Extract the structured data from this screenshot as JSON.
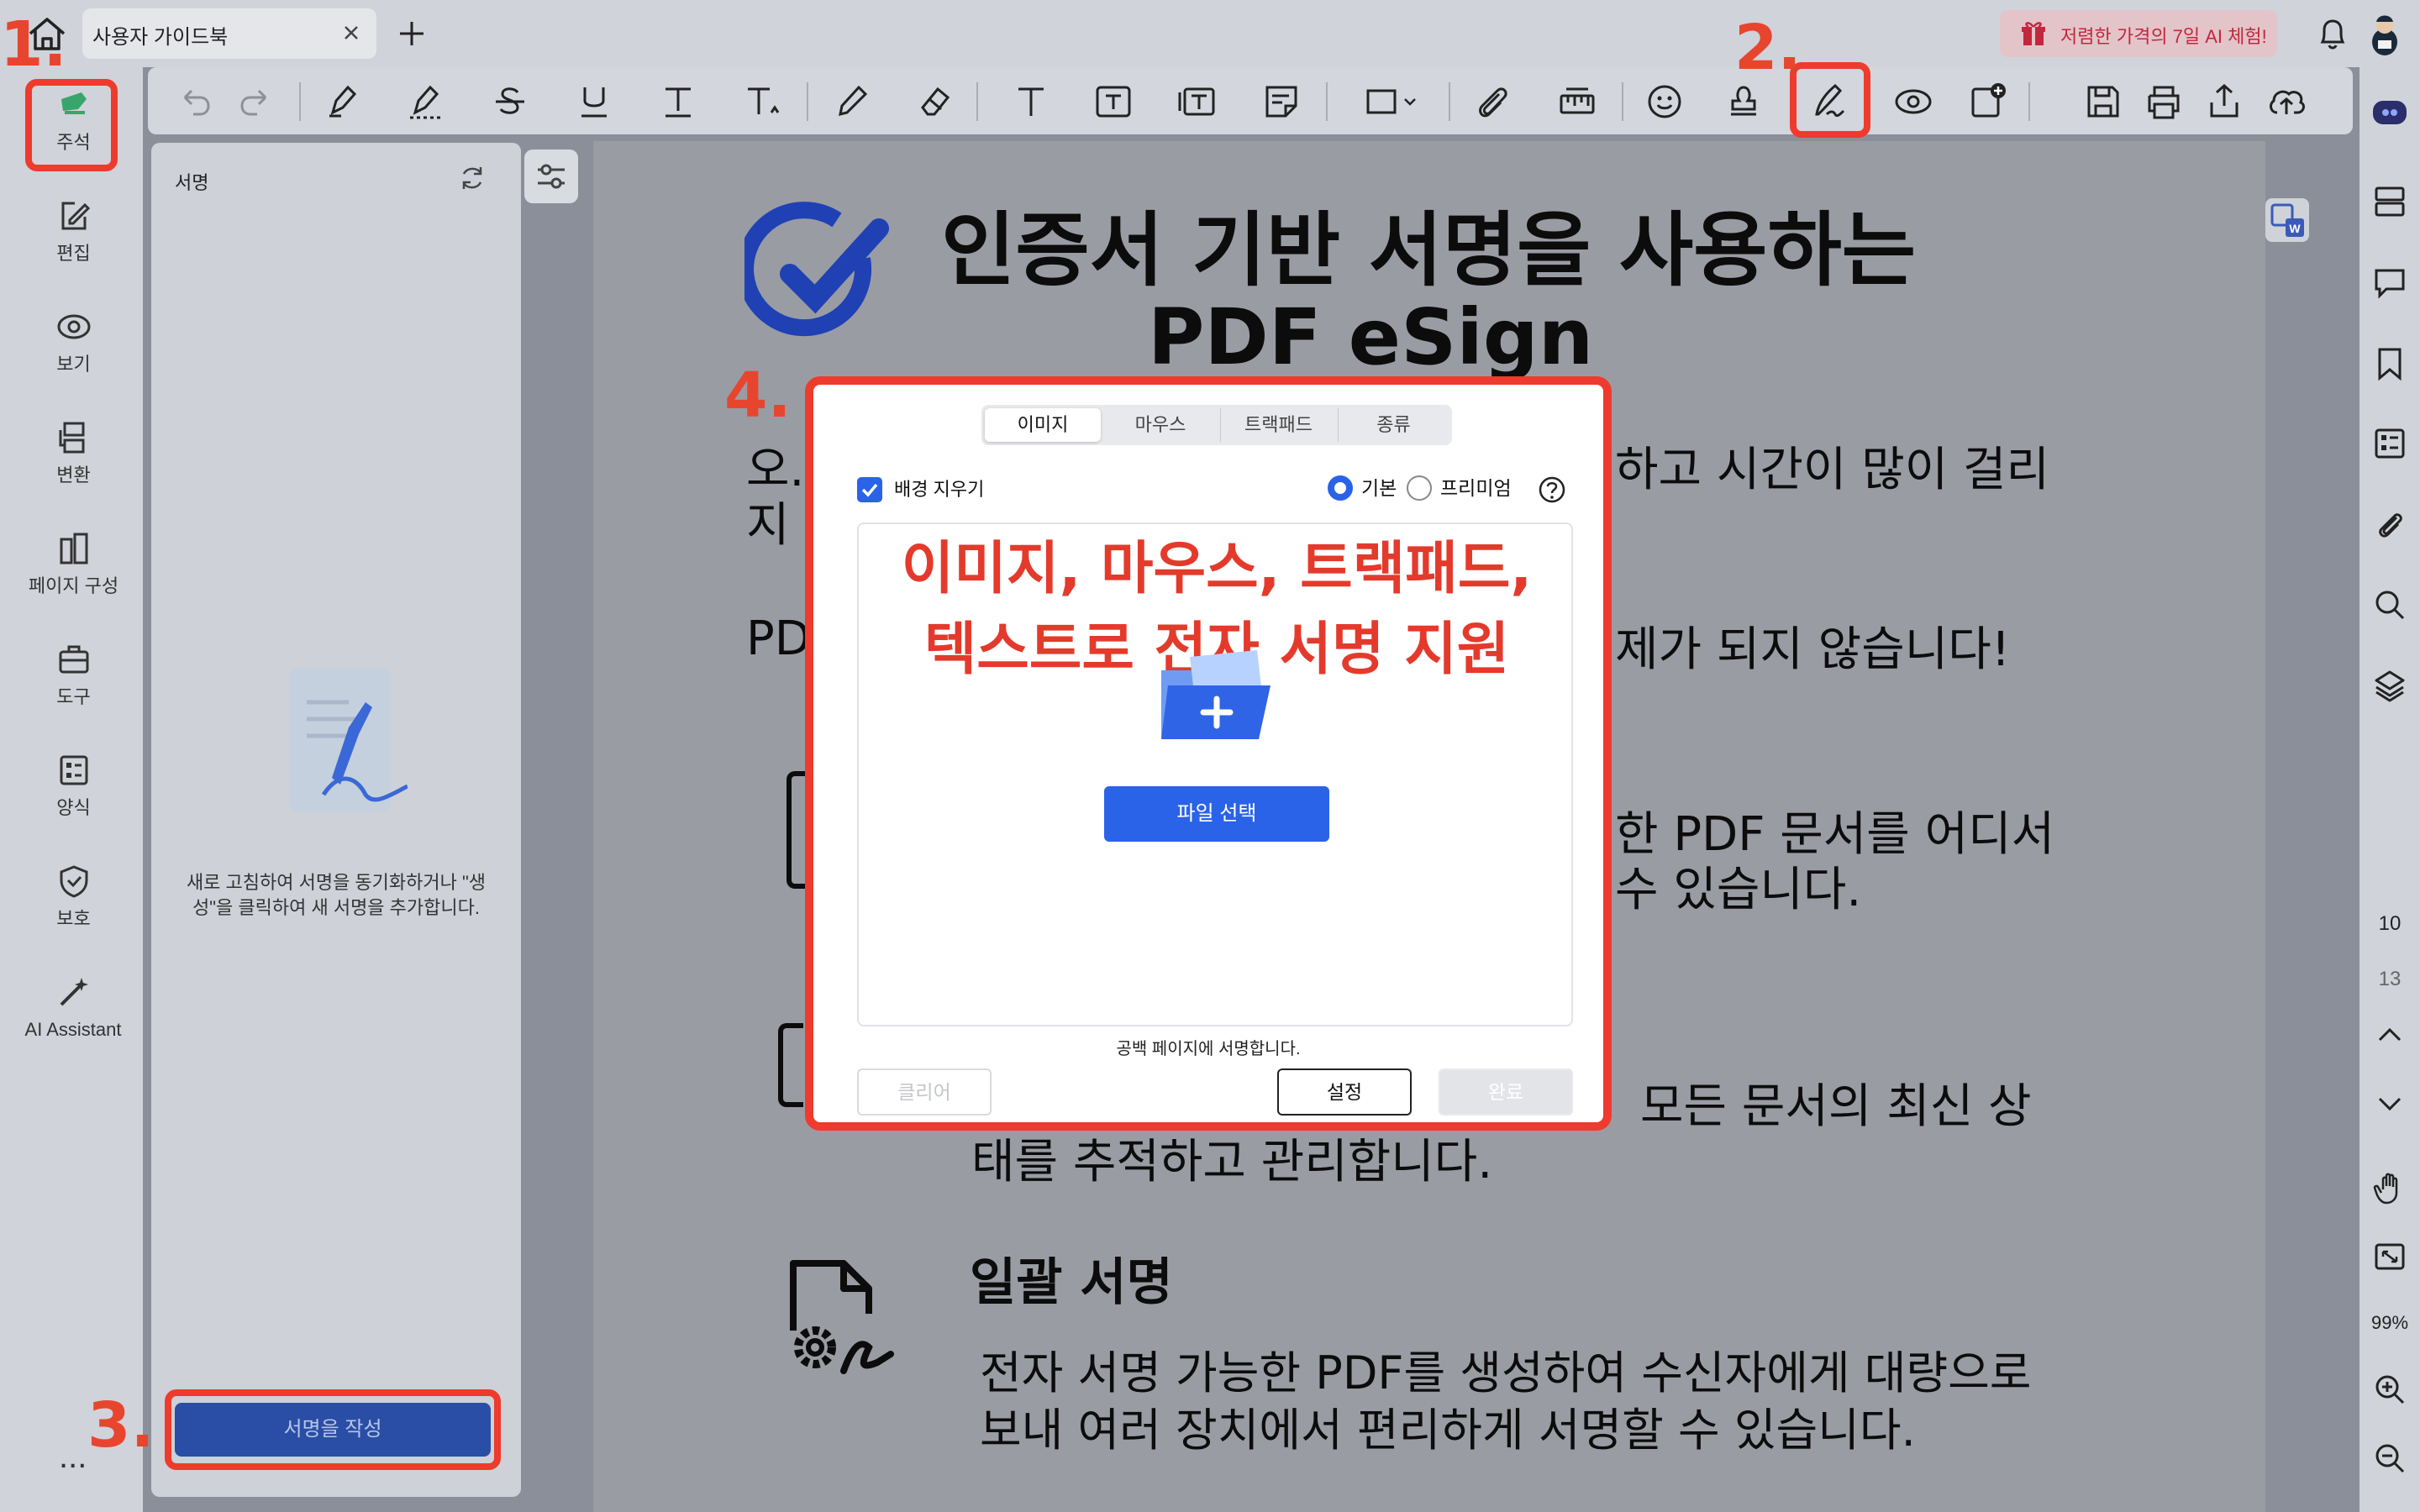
{
  "tabbar": {
    "doc_tab_title": "사용자 가이드북",
    "promo_text": "저렴한 가격의 7일 AI 체험!"
  },
  "leftnav": {
    "items": [
      {
        "label": "주석",
        "icon": "comment-marker-icon"
      },
      {
        "label": "편집",
        "icon": "edit-icon"
      },
      {
        "label": "보기",
        "icon": "eye-icon"
      },
      {
        "label": "변환",
        "icon": "convert-icon"
      },
      {
        "label": "페이지 구성",
        "icon": "page-organize-icon"
      },
      {
        "label": "도구",
        "icon": "toolbox-icon"
      },
      {
        "label": "양식",
        "icon": "form-icon"
      },
      {
        "label": "보호",
        "icon": "shield-icon"
      },
      {
        "label": "AI Assistant",
        "icon": "ai-wand-icon"
      }
    ],
    "ellipsis": "..."
  },
  "toolbar": {
    "icons": [
      "undo-icon",
      "redo-icon",
      "highlighter-icon",
      "area-highlight-icon",
      "strikethrough-icon",
      "underline-icon",
      "text-replace-icon",
      "text-insert-icon",
      "pencil-icon",
      "eraser-icon",
      "text-icon",
      "text-box-icon",
      "text-callout-icon",
      "sticky-note-icon",
      "shape-icon",
      "attachment-icon",
      "measure-icon",
      "sticker-icon",
      "stamp-icon",
      "signature-icon",
      "eye-icon",
      "add-note-icon",
      "save-icon",
      "print-icon",
      "share-icon",
      "cloud-upload-icon"
    ]
  },
  "sidepanel": {
    "title": "서명",
    "empty_text": "새로 고침하여 서명을 동기화하거나 \"생성\"을 클릭하여 새 서명을 추가합니다.",
    "create_button": "서명을 작성"
  },
  "document": {
    "title_line1": "인증서 기반 서명을 사용하는",
    "title_line2": "PDF eSign",
    "p1_left_a": "오.",
    "p1_left_b": "지",
    "p1_right": "하고 시간이 많이 걸리",
    "p2_left": "PD",
    "p2_right": "제가 되지 않습니다!",
    "p3_right_a": "한 PDF 문서를 어디서",
    "p3_right_b": "수 있습니다.",
    "p4_right": "모든 문서의 최신 상",
    "p4_line2": "태를 추적하고 관리합니다.",
    "section_title": "일괄 서명",
    "section_line1": "전자 서명 가능한 PDF를 생성하여 수신자에게 대량으로",
    "section_line2": "보내 여러 장치에서 편리하게 서명할 수 있습니다."
  },
  "modal": {
    "tabs": [
      "이미지",
      "마우스",
      "트랙패드",
      "종류"
    ],
    "active_tab": "이미지",
    "remove_bg_label": "배경 지우기",
    "remove_bg_checked": true,
    "radio_basic": "기본",
    "radio_premium": "프리미엄",
    "selected_radio": "기본",
    "overlay_line1": "이미지, 마우스, 트랙패드,",
    "overlay_line2": "텍스트로 전자 서명 지원",
    "choose_file": "파일 선택",
    "blank_note": "공백 페이지에 서명합니다.",
    "btn_clear": "클리어",
    "btn_settings": "설정",
    "btn_done": "완료"
  },
  "rightrail": {
    "page_current": "10",
    "page_total": "13",
    "zoom": "99%"
  },
  "steps": [
    "1.",
    "2.",
    "3.",
    "4."
  ],
  "colors": {
    "highlight_red": "#ee3b2d",
    "accent_blue": "#2a63e8",
    "overlay_text_red": "#e33a2c"
  }
}
